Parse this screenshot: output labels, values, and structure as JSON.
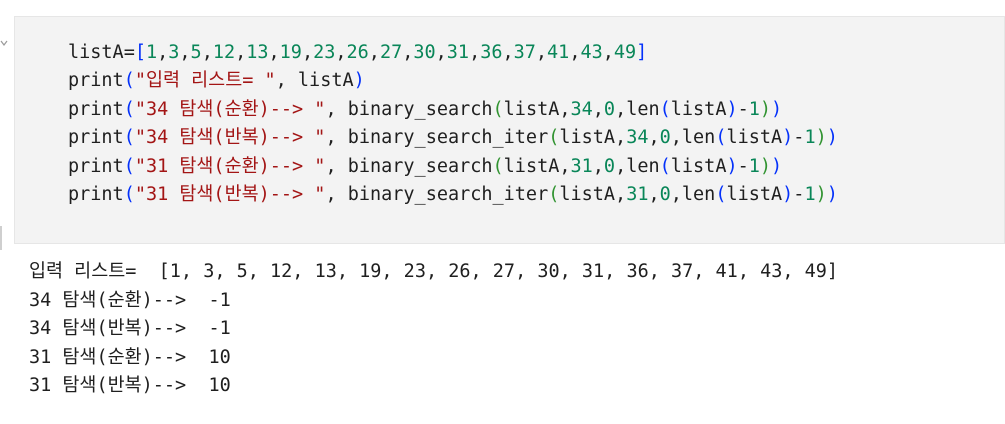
{
  "code_cell": {
    "lines": [
      [
        {
          "t": "listA",
          "c": "name"
        },
        {
          "t": "=",
          "c": "punct"
        },
        {
          "t": "[",
          "c": "br1"
        },
        {
          "t": "1",
          "c": "num"
        },
        {
          "t": ",",
          "c": "punct"
        },
        {
          "t": "3",
          "c": "num"
        },
        {
          "t": ",",
          "c": "punct"
        },
        {
          "t": "5",
          "c": "num"
        },
        {
          "t": ",",
          "c": "punct"
        },
        {
          "t": "12",
          "c": "num"
        },
        {
          "t": ",",
          "c": "punct"
        },
        {
          "t": "13",
          "c": "num"
        },
        {
          "t": ",",
          "c": "punct"
        },
        {
          "t": "19",
          "c": "num"
        },
        {
          "t": ",",
          "c": "punct"
        },
        {
          "t": "23",
          "c": "num"
        },
        {
          "t": ",",
          "c": "punct"
        },
        {
          "t": "26",
          "c": "num"
        },
        {
          "t": ",",
          "c": "punct"
        },
        {
          "t": "27",
          "c": "num"
        },
        {
          "t": ",",
          "c": "punct"
        },
        {
          "t": "30",
          "c": "num"
        },
        {
          "t": ",",
          "c": "punct"
        },
        {
          "t": "31",
          "c": "num"
        },
        {
          "t": ",",
          "c": "punct"
        },
        {
          "t": "36",
          "c": "num"
        },
        {
          "t": ",",
          "c": "punct"
        },
        {
          "t": "37",
          "c": "num"
        },
        {
          "t": ",",
          "c": "punct"
        },
        {
          "t": "41",
          "c": "num"
        },
        {
          "t": ",",
          "c": "punct"
        },
        {
          "t": "43",
          "c": "num"
        },
        {
          "t": ",",
          "c": "punct"
        },
        {
          "t": "49",
          "c": "num"
        },
        {
          "t": "]",
          "c": "br1"
        }
      ],
      [
        {
          "t": "print",
          "c": "name"
        },
        {
          "t": "(",
          "c": "br1"
        },
        {
          "t": "\"입력 리스트= \"",
          "c": "str"
        },
        {
          "t": ", listA",
          "c": "name"
        },
        {
          "t": ")",
          "c": "br1"
        }
      ],
      [
        {
          "t": "print",
          "c": "name"
        },
        {
          "t": "(",
          "c": "br1"
        },
        {
          "t": "\"34 탐색(순환)--> \"",
          "c": "str"
        },
        {
          "t": ", binary_search",
          "c": "name"
        },
        {
          "t": "(",
          "c": "br2"
        },
        {
          "t": "listA,",
          "c": "name"
        },
        {
          "t": "34",
          "c": "num"
        },
        {
          "t": ",",
          "c": "punct"
        },
        {
          "t": "0",
          "c": "num"
        },
        {
          "t": ",len",
          "c": "name"
        },
        {
          "t": "(",
          "c": "br1"
        },
        {
          "t": "listA",
          "c": "name"
        },
        {
          "t": ")",
          "c": "br1"
        },
        {
          "t": "-",
          "c": "punct"
        },
        {
          "t": "1",
          "c": "num"
        },
        {
          "t": ")",
          "c": "br2"
        },
        {
          "t": ")",
          "c": "br1"
        }
      ],
      [
        {
          "t": "print",
          "c": "name"
        },
        {
          "t": "(",
          "c": "br1"
        },
        {
          "t": "\"34 탐색(반복)--> \"",
          "c": "str"
        },
        {
          "t": ", binary_search_iter",
          "c": "name"
        },
        {
          "t": "(",
          "c": "br2"
        },
        {
          "t": "listA,",
          "c": "name"
        },
        {
          "t": "34",
          "c": "num"
        },
        {
          "t": ",",
          "c": "punct"
        },
        {
          "t": "0",
          "c": "num"
        },
        {
          "t": ",len",
          "c": "name"
        },
        {
          "t": "(",
          "c": "br1"
        },
        {
          "t": "listA",
          "c": "name"
        },
        {
          "t": ")",
          "c": "br1"
        },
        {
          "t": "-",
          "c": "punct"
        },
        {
          "t": "1",
          "c": "num"
        },
        {
          "t": ")",
          "c": "br2"
        },
        {
          "t": ")",
          "c": "br1"
        }
      ],
      [
        {
          "t": "print",
          "c": "name"
        },
        {
          "t": "(",
          "c": "br1"
        },
        {
          "t": "\"31 탐색(순환)--> \"",
          "c": "str"
        },
        {
          "t": ", binary_search",
          "c": "name"
        },
        {
          "t": "(",
          "c": "br2"
        },
        {
          "t": "listA,",
          "c": "name"
        },
        {
          "t": "31",
          "c": "num"
        },
        {
          "t": ",",
          "c": "punct"
        },
        {
          "t": "0",
          "c": "num"
        },
        {
          "t": ",len",
          "c": "name"
        },
        {
          "t": "(",
          "c": "br1"
        },
        {
          "t": "listA",
          "c": "name"
        },
        {
          "t": ")",
          "c": "br1"
        },
        {
          "t": "-",
          "c": "punct"
        },
        {
          "t": "1",
          "c": "num"
        },
        {
          "t": ")",
          "c": "br2"
        },
        {
          "t": ")",
          "c": "br1"
        }
      ],
      [
        {
          "t": "print",
          "c": "name"
        },
        {
          "t": "(",
          "c": "br1"
        },
        {
          "t": "\"31 탐색(반복)--> \"",
          "c": "str"
        },
        {
          "t": ", binary_search_iter",
          "c": "name"
        },
        {
          "t": "(",
          "c": "br2"
        },
        {
          "t": "listA,",
          "c": "name"
        },
        {
          "t": "31",
          "c": "num"
        },
        {
          "t": ",",
          "c": "punct"
        },
        {
          "t": "0",
          "c": "num"
        },
        {
          "t": ",len",
          "c": "name"
        },
        {
          "t": "(",
          "c": "br1"
        },
        {
          "t": "listA",
          "c": "name"
        },
        {
          "t": ")",
          "c": "br1"
        },
        {
          "t": "-",
          "c": "punct"
        },
        {
          "t": "1",
          "c": "num"
        },
        {
          "t": ")",
          "c": "br2"
        },
        {
          "t": ")",
          "c": "br1"
        }
      ]
    ]
  },
  "output": {
    "line_1": "입력 리스트=  [1, 3, 5, 12, 13, 19, 23, 26, 27, 30, 31, 36, 37, 41, 43, 49]",
    "line_2": "34 탐색(순환)-->  -1",
    "line_3": "34 탐색(반복)-->  -1",
    "line_4": "31 탐색(순환)-->  10",
    "line_5": "31 탐색(반복)-->  10"
  },
  "icons": {
    "collapse": "chevron-down-icon"
  },
  "colors": {
    "cell_background": "#f3f3f3",
    "number": "#098658",
    "string": "#a31515",
    "bracket_level_1": "#0431fa",
    "bracket_level_2": "#319331",
    "text": "#1f1f1f"
  }
}
